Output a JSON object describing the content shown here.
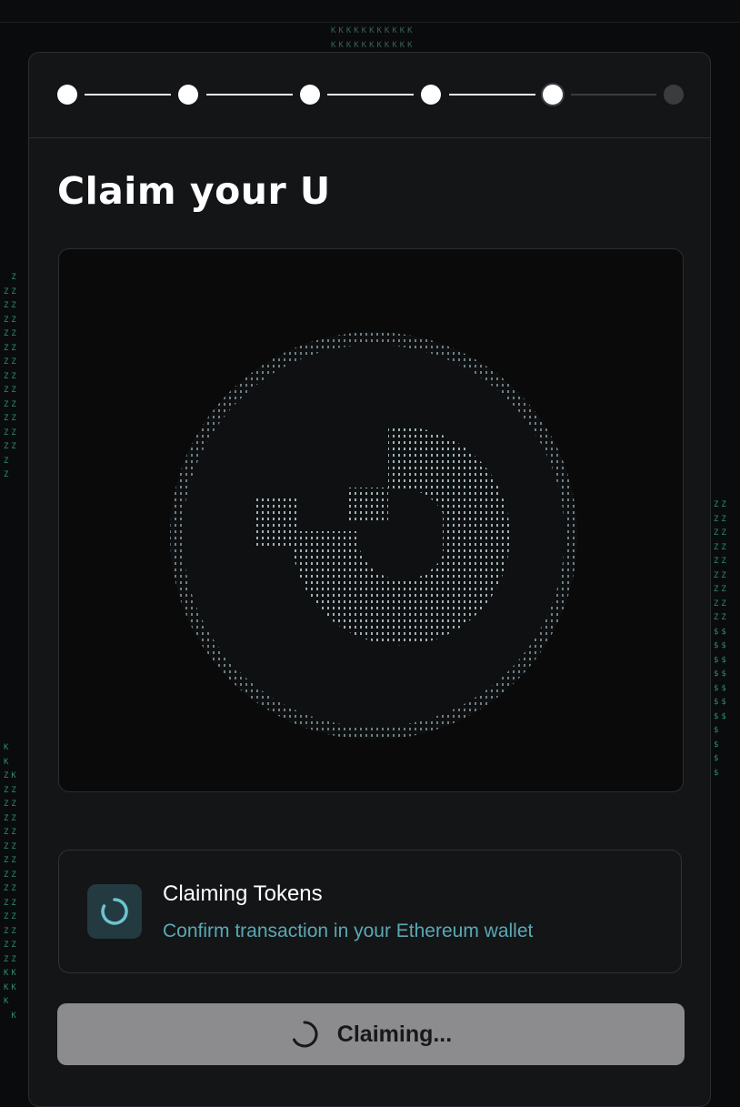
{
  "stepper": {
    "steps": [
      {
        "state": "complete"
      },
      {
        "state": "complete"
      },
      {
        "state": "complete"
      },
      {
        "state": "complete"
      },
      {
        "state": "current"
      },
      {
        "state": "pending"
      }
    ]
  },
  "page": {
    "title": "Claim your U"
  },
  "visual": {
    "icon": "u-token-ascii-logo-icon"
  },
  "status": {
    "icon": "spinner-icon",
    "title": "Claiming Tokens",
    "subtitle": "Confirm transaction in your Ethereum wallet"
  },
  "claim_button": {
    "label": "Claiming...",
    "icon": "spinner-icon",
    "disabled": true
  },
  "colors": {
    "background": "#0a0b0c",
    "card": "#141517",
    "border": "#2a2d31",
    "accent_teal": "#5aa9b4",
    "button_disabled": "#8c8c8e",
    "step_pending": "#3a3c40"
  }
}
